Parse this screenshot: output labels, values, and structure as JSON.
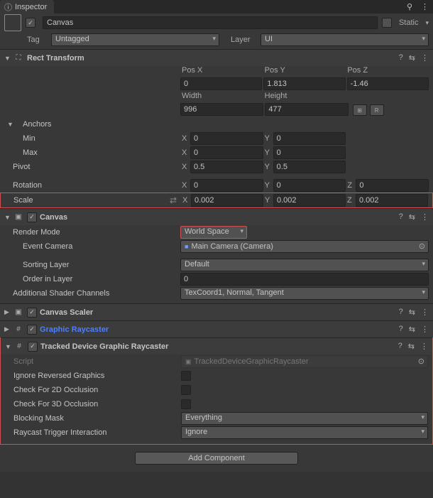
{
  "tab": {
    "title": "Inspector",
    "lock_icon": "lock-icon"
  },
  "header": {
    "enabled": true,
    "name": "Canvas",
    "static_label": "Static",
    "tag_label": "Tag",
    "tag_value": "Untagged",
    "layer_label": "Layer",
    "layer_value": "UI"
  },
  "rect_transform": {
    "title": "Rect Transform",
    "pos_labels": [
      "Pos X",
      "Pos Y",
      "Pos Z"
    ],
    "pos": [
      "0",
      "1.813",
      "-1.46"
    ],
    "size_labels": [
      "Width",
      "Height"
    ],
    "size": [
      "996",
      "477"
    ],
    "anchors_label": "Anchors",
    "min_label": "Min",
    "min": {
      "x": "0",
      "y": "0"
    },
    "max_label": "Max",
    "max": {
      "x": "0",
      "y": "0"
    },
    "pivot_label": "Pivot",
    "pivot": {
      "x": "0.5",
      "y": "0.5"
    },
    "rotation_label": "Rotation",
    "rotation": {
      "x": "0",
      "y": "0",
      "z": "0"
    },
    "scale_label": "Scale",
    "scale": {
      "x": "0.002",
      "y": "0.002",
      "z": "0.002"
    },
    "raw_btn": "R"
  },
  "canvas_comp": {
    "title": "Canvas",
    "render_mode_label": "Render Mode",
    "render_mode": "World Space",
    "event_camera_label": "Event Camera",
    "event_camera": "Main Camera (Camera)",
    "sorting_layer_label": "Sorting Layer",
    "sorting_layer": "Default",
    "order_label": "Order in Layer",
    "order": "0",
    "channels_label": "Additional Shader Channels",
    "channels": "TexCoord1, Normal, Tangent"
  },
  "canvas_scaler": {
    "title": "Canvas Scaler"
  },
  "graphic_raycaster": {
    "title": "Graphic Raycaster"
  },
  "tracked": {
    "title": "Tracked Device Graphic Raycaster",
    "script_label": "Script",
    "script_value": "TrackedDeviceGraphicRaycaster",
    "ignore_rev_label": "Ignore Reversed Graphics",
    "check2d_label": "Check For 2D Occlusion",
    "check3d_label": "Check For 3D Occlusion",
    "blocking_mask_label": "Blocking Mask",
    "blocking_mask": "Everything",
    "trigger_label": "Raycast Trigger Interaction",
    "trigger": "Ignore"
  },
  "add_component": "Add Component",
  "axes": {
    "x": "X",
    "y": "Y",
    "z": "Z"
  }
}
